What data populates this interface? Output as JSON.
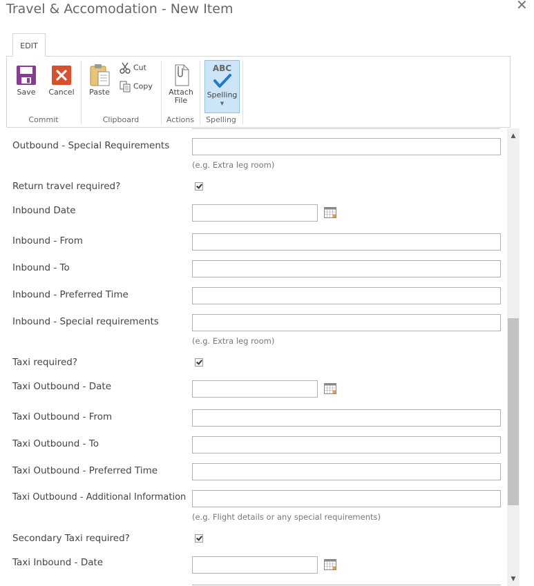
{
  "window": {
    "title": "Travel & Accomodation - New Item",
    "close_icon": "close-icon"
  },
  "ribbon": {
    "tab": "EDIT",
    "groups": {
      "commit": {
        "label": "Commit",
        "save": "Save",
        "cancel": "Cancel"
      },
      "clipboard": {
        "label": "Clipboard",
        "paste": "Paste",
        "cut": "Cut",
        "copy": "Copy"
      },
      "actions": {
        "label": "Actions",
        "attach_line1": "Attach",
        "attach_line2": "File"
      },
      "spelling": {
        "label": "Spelling",
        "button": "Spelling",
        "abc": "ABC"
      }
    },
    "colors": {
      "save": "#8a3b96",
      "cancel": "#d9512c",
      "spelling_highlight": "#cde6f7"
    }
  },
  "form": {
    "outbound_special": {
      "label": "Outbound - Special Requirements",
      "value": "",
      "hint": "(e.g. Extra leg room)"
    },
    "return_required": {
      "label": "Return travel required?",
      "checked": true
    },
    "inbound_date": {
      "label": "Inbound Date",
      "value": ""
    },
    "inbound_from": {
      "label": "Inbound - From",
      "value": ""
    },
    "inbound_to": {
      "label": "Inbound - To",
      "value": ""
    },
    "inbound_time": {
      "label": "Inbound - Preferred Time",
      "value": ""
    },
    "inbound_special": {
      "label": "Inbound - Special requirements",
      "value": "",
      "hint": "(e.g. Extra leg room)"
    },
    "taxi_required": {
      "label": "Taxi required?",
      "checked": true
    },
    "taxi_out_date": {
      "label": "Taxi Outbound - Date",
      "value": ""
    },
    "taxi_out_from": {
      "label": "Taxi Outbound - From",
      "value": ""
    },
    "taxi_out_to": {
      "label": "Taxi Outbound - To",
      "value": ""
    },
    "taxi_out_time": {
      "label": "Taxi Outbound - Preferred Time",
      "value": ""
    },
    "taxi_out_info": {
      "label": "Taxi Outbound - Additional Information",
      "value": "",
      "hint": "(e.g. Flight details or any special requirements)"
    },
    "secondary_taxi": {
      "label": "Secondary Taxi required?",
      "checked": true
    },
    "taxi_in_date": {
      "label": "Taxi Inbound - Date",
      "value": ""
    }
  }
}
